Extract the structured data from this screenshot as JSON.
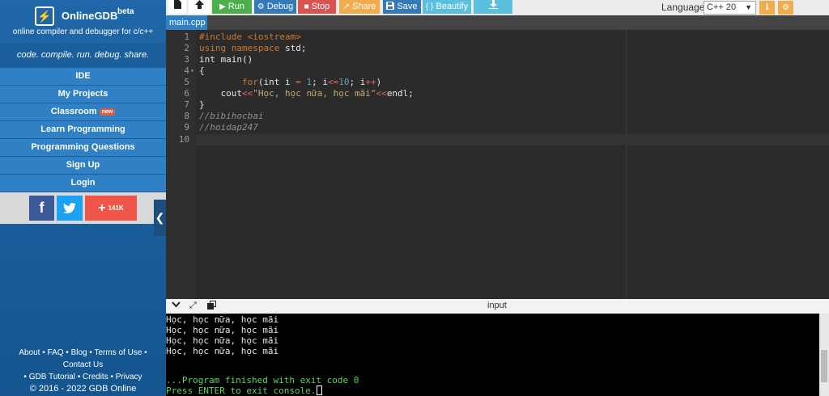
{
  "brand": {
    "name": "OnlineGDB",
    "beta": "beta",
    "subtitle": "online compiler and debugger for c/c++",
    "tagline": "code. compile. run. debug. share."
  },
  "nav": [
    {
      "label": "IDE"
    },
    {
      "label": "My Projects"
    },
    {
      "label": "Classroom",
      "badge": "new"
    },
    {
      "label": "Learn Programming"
    },
    {
      "label": "Programming Questions"
    },
    {
      "label": "Sign Up"
    },
    {
      "label": "Login"
    }
  ],
  "social": {
    "facebook_glyph": "f",
    "twitter_glyph": "t",
    "share_glyph": "+",
    "share_count": "141K"
  },
  "footer": {
    "line1": [
      "About",
      "FAQ",
      "Blog",
      "Terms of Use",
      "Contact Us"
    ],
    "line2": [
      "GDB Tutorial",
      "Credits",
      "Privacy"
    ],
    "copyright": "© 2016 - 2022 GDB Online"
  },
  "toolbar": {
    "run": "Run",
    "debug": "Debug",
    "stop": "Stop",
    "share": "Share",
    "save": "Save",
    "beautify": "Beautify",
    "language_label": "Language",
    "language_value": "C++ 20",
    "colors": {
      "run": "#4cae4c",
      "debug": "#337ab7",
      "stop": "#d9534f",
      "share": "#f0ad4e",
      "save": "#337ab7",
      "beautify": "#5bc0de",
      "download": "#5bc0de"
    }
  },
  "tabs": [
    {
      "label": "main.cpp"
    }
  ],
  "editor": {
    "line_numbers": [
      "1",
      "2",
      "3",
      "4",
      "5",
      "6",
      "7",
      "8",
      "9",
      "10"
    ],
    "lines": [
      "#include <iostream>",
      "using namespace std;",
      "int main()",
      "{",
      "        for(int i = 1; i<=10; i++)",
      "    cout<<\"Học, học nữa, học mãi\"<<endl;",
      "}",
      "//bibihocbai",
      "//hoidap247",
      ""
    ]
  },
  "console": {
    "input_label": "input",
    "output": [
      "Học, học nữa, học mãi",
      "Học, học nữa, học mãi",
      "Học, học nữa, học mãi",
      "Học, học nữa, học mãi",
      "",
      "...Program finished with exit code 0",
      "Press ENTER to exit console."
    ]
  }
}
